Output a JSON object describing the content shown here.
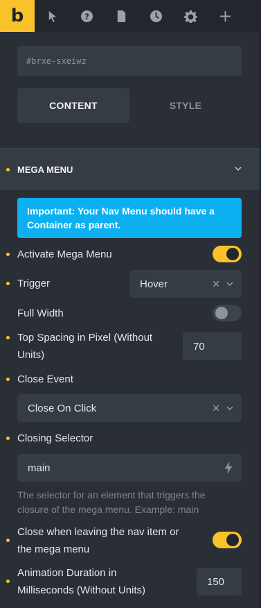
{
  "topbar": {
    "logo": "b",
    "icons": [
      "cursor-icon",
      "help-icon",
      "page-icon",
      "history-icon",
      "settings-icon",
      "add-icon"
    ]
  },
  "element_id": "#brxe-sxeiwz",
  "tabs": {
    "content": "CONTENT",
    "style": "STYLE"
  },
  "section": {
    "title": "MEGA MENU"
  },
  "notice": "Important: Your Nav Menu should have a Container as parent.",
  "fields": {
    "activate_mega_menu": {
      "label": "Activate Mega Menu",
      "enabled": true
    },
    "trigger": {
      "label": "Trigger",
      "value": "Hover"
    },
    "full_width": {
      "label": "Full Width",
      "enabled": false
    },
    "top_spacing": {
      "label_line1": "Top Spacing in Pixel (Without",
      "label_line2": "Units)",
      "value": "70"
    },
    "close_event": {
      "label": "Close Event",
      "value": "Close On Click"
    },
    "closing_selector": {
      "label": "Closing Selector",
      "value": "main",
      "help_line1": "The selector for an element that triggers the",
      "help_line2": "closure of the mega menu. Example: main"
    },
    "close_on_leave": {
      "label_line1": "Close when leaving the nav item or",
      "label_line2": "the mega menu",
      "enabled": true
    },
    "animation_duration": {
      "label_line1": "Animation Duration in",
      "label_line2": "Milliseconds (Without Units)",
      "value": "150"
    }
  },
  "colors": {
    "accent": "#f9c22b",
    "notice": "#0cb0f0",
    "panel": "#2a2f36",
    "field": "#363c44"
  }
}
